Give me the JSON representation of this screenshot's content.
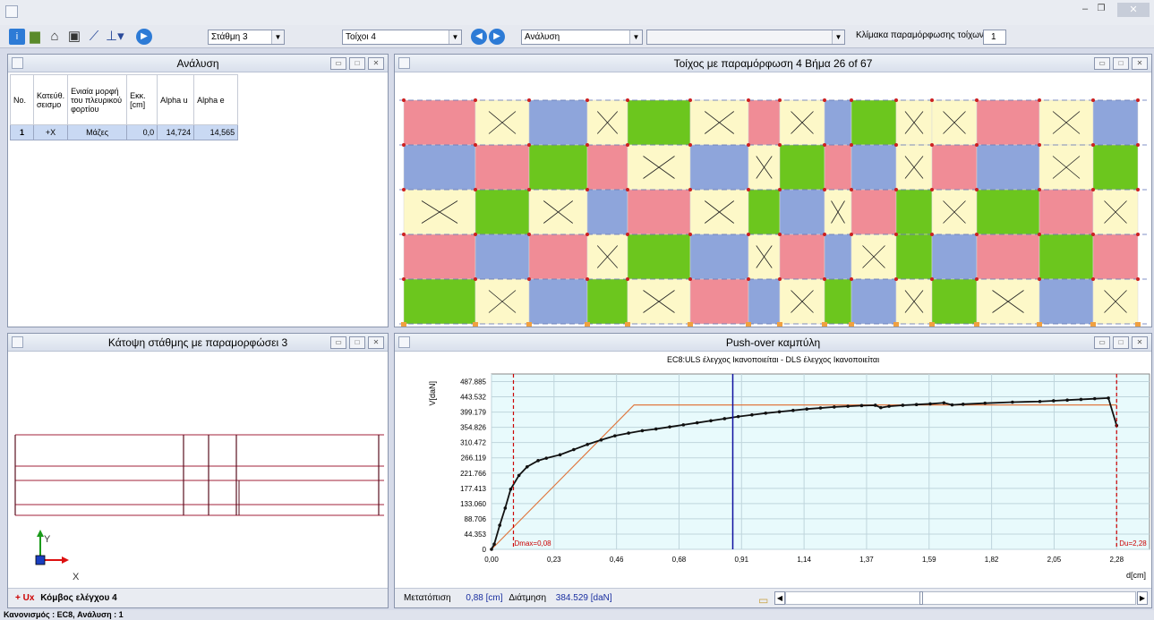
{
  "toolbar": {
    "level_combo": "Στάθμη 3",
    "wall_combo": "Τοίχοι 4",
    "analysis_combo": "Ανάλυση",
    "empty_combo": "",
    "scale_label": "Κλίμακα παραμόρφωσης τοίχων",
    "scale_value": "1"
  },
  "analysis_panel": {
    "title": "Ανάλυση",
    "columns": [
      "No.",
      "Κατεύθ. σεισμο",
      "Ενιαία μορφή του πλευρικού φορτίου",
      "Εκκ. [cm]",
      "Alpha u",
      "Alpha e"
    ],
    "rows": [
      {
        "no": "1",
        "dir": "+X",
        "form": "Μάζες",
        "ecc": "0,0",
        "au": "14,724",
        "ae": "14,565"
      }
    ]
  },
  "wall_panel": {
    "title": "Τοίχος με παραμόρφωση 4 Βήμα 26 of 67"
  },
  "plan_panel": {
    "title": "Κάτοψη στάθμης με παραμορφώσει 3",
    "status_prefix": "+ Ux",
    "status_text": "Κόμβος ελέγχου 4",
    "axis_x": "X",
    "axis_y": "Y"
  },
  "pushover_panel": {
    "title": "Push-over καμπύλη",
    "subtitle": "EC8:ULS έλεγχος Ικανοποιείται - DLS έλεγχος Ικανοποιείται",
    "status_disp_label": "Μετατόπιση",
    "status_disp_value": "0,88 [cm]",
    "status_shear_label": "Διάτμηση",
    "status_shear_value": "384.529 [daN]"
  },
  "chart_data": {
    "type": "line",
    "ylabel": "V[daN]",
    "xlabel": "d[cm]",
    "x_ticks": [
      "0,00",
      "0,23",
      "0,46",
      "0,68",
      "0,91",
      "1,14",
      "1,37",
      "1,59",
      "1,82",
      "2,05",
      "2,28"
    ],
    "y_ticks": [
      "0",
      "44.353",
      "88.706",
      "133.060",
      "177.413",
      "221.766",
      "266.119",
      "310.472",
      "354.826",
      "399.179",
      "443.532",
      "487.885"
    ],
    "xlim": [
      0,
      2.4
    ],
    "ylim": [
      0,
      510000
    ],
    "series": [
      {
        "values": [
          [
            0,
            0
          ],
          [
            0.01,
            15000
          ],
          [
            0.03,
            70000
          ],
          [
            0.05,
            120000
          ],
          [
            0.07,
            175000
          ],
          [
            0.1,
            215000
          ],
          [
            0.13,
            240000
          ],
          [
            0.17,
            258000
          ],
          [
            0.2,
            265000
          ],
          [
            0.25,
            275000
          ],
          [
            0.3,
            290000
          ],
          [
            0.35,
            305000
          ],
          [
            0.4,
            318000
          ],
          [
            0.45,
            330000
          ],
          [
            0.5,
            338000
          ],
          [
            0.55,
            345000
          ],
          [
            0.6,
            350000
          ],
          [
            0.65,
            356000
          ],
          [
            0.7,
            362000
          ],
          [
            0.75,
            368000
          ],
          [
            0.8,
            374000
          ],
          [
            0.85,
            380000
          ],
          [
            0.9,
            386000
          ],
          [
            0.95,
            391000
          ],
          [
            1.0,
            396000
          ],
          [
            1.05,
            400000
          ],
          [
            1.1,
            404000
          ],
          [
            1.15,
            408000
          ],
          [
            1.2,
            411000
          ],
          [
            1.25,
            414000
          ],
          [
            1.3,
            416000
          ],
          [
            1.35,
            418000
          ],
          [
            1.4,
            419000
          ],
          [
            1.42,
            412000
          ],
          [
            1.45,
            416000
          ],
          [
            1.5,
            419000
          ],
          [
            1.55,
            421000
          ],
          [
            1.6,
            423000
          ],
          [
            1.65,
            426000
          ],
          [
            1.68,
            420000
          ],
          [
            1.72,
            422000
          ],
          [
            1.8,
            425000
          ],
          [
            1.9,
            428000
          ],
          [
            2.0,
            430000
          ],
          [
            2.05,
            432000
          ],
          [
            2.1,
            434000
          ],
          [
            2.15,
            436000
          ],
          [
            2.2,
            438000
          ],
          [
            2.25,
            440000
          ],
          [
            2.28,
            360000
          ]
        ]
      },
      {
        "values": [
          [
            0,
            0
          ],
          [
            0.52,
            420000
          ],
          [
            2.28,
            420000
          ]
        ],
        "color": "#e07840"
      }
    ],
    "markers": [
      {
        "x": 0.08,
        "label": "Dmax=0,08",
        "color": "#cc0000"
      },
      {
        "x": 2.28,
        "label": "Du=2,28",
        "color": "#cc0000"
      },
      {
        "x": 0.88,
        "label": "",
        "color": "#1010a0"
      }
    ]
  },
  "footer": {
    "text": "Κανονισμός : EC8, Ανάλυση : 1"
  }
}
